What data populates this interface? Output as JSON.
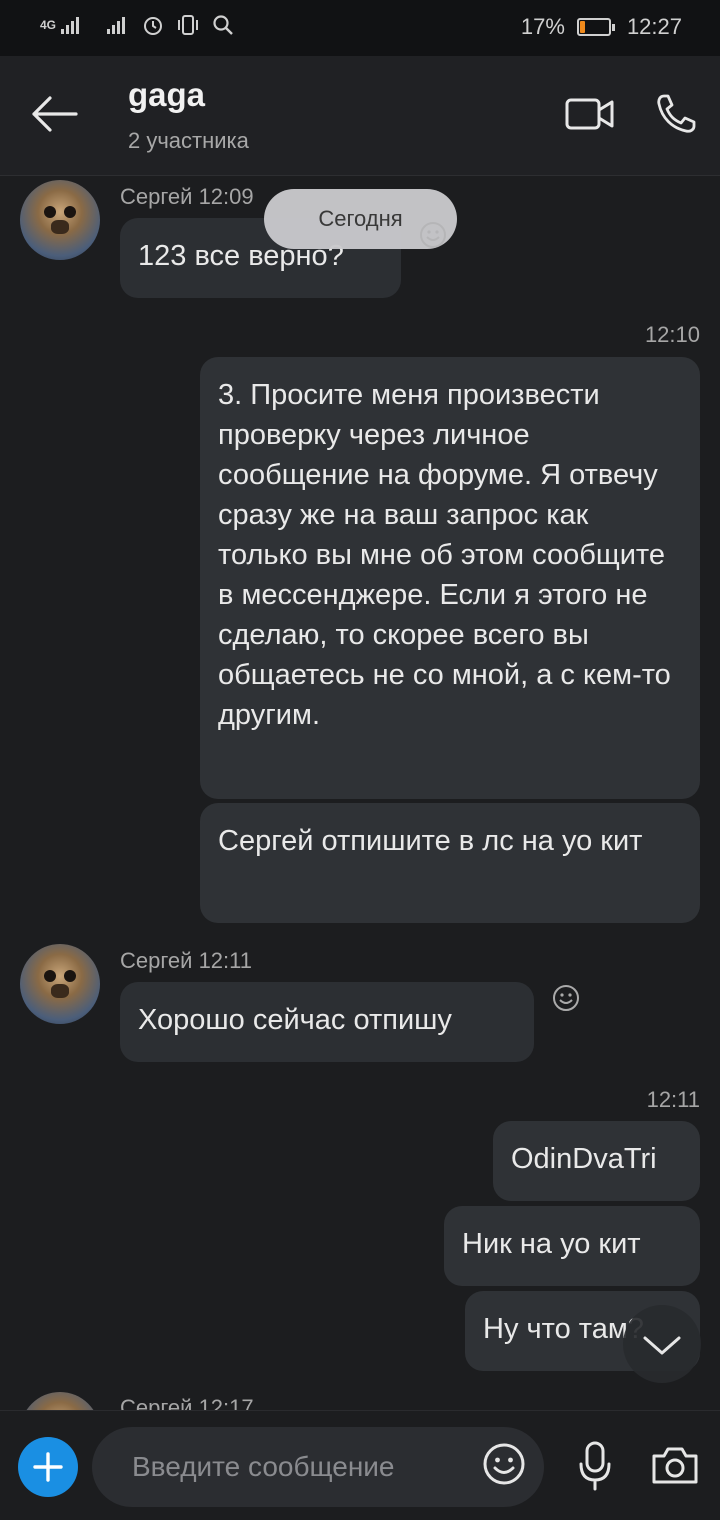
{
  "status_bar": {
    "network": "4G",
    "battery_percent": "17%",
    "battery_level": 0.17,
    "time": "12:27",
    "icons": [
      "signal-icon",
      "signal-icon",
      "alarm-icon",
      "vibrate-icon",
      "search-icon"
    ]
  },
  "header": {
    "title": "gaga",
    "subtitle": "2 участника"
  },
  "chat": {
    "date_pill": "Сегодня",
    "messages": [
      {
        "sender": "Сергей",
        "time": "12:09",
        "text": "123 все верно?"
      },
      {
        "time": "12:10",
        "text": "3. Просите меня произвести проверку через личное сообщение на форуме. Я отвечу сразу же на ваш запрос как только вы мне об этом сообщите в мессенджере. Если я этого не сделаю, то скорее всего вы общаетесь не со мной, а с кем-то другим."
      },
      {
        "text": "Сергей отпишите в лс на уо кит"
      },
      {
        "sender": "Сергей",
        "time": "12:11",
        "text": "Хорошо сейчас отпишу"
      },
      {
        "time": "12:11",
        "text": "OdinDvaTri"
      },
      {
        "text": "Ник на уо кит"
      },
      {
        "text": "Ну что там?"
      },
      {
        "sender": "Сергей",
        "time": "12:17"
      }
    ]
  },
  "composer": {
    "placeholder": "Введите сообщение"
  },
  "colors": {
    "accent": "#1a8fe3",
    "background": "#1c1d1f",
    "bubble": "#2c2f33",
    "battery_low": "#f08a1c"
  }
}
